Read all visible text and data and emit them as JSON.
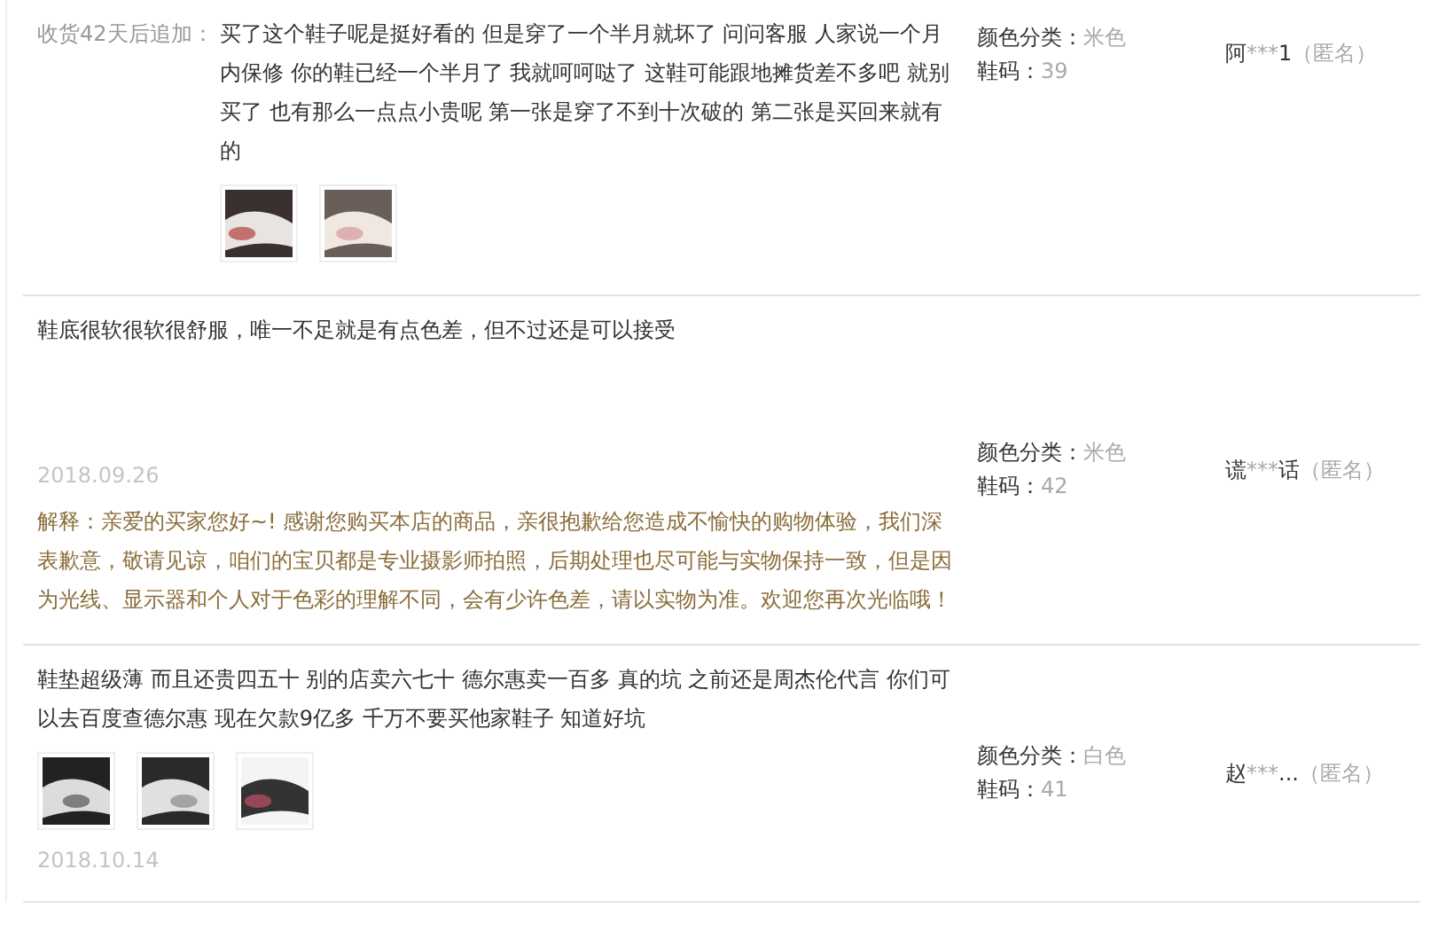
{
  "reviews": [
    {
      "append_label": "收货42天后追加：",
      "text": "买了这个鞋子呢是挺好看的 但是穿了一个半月就坏了 问问客服 人家说一个月内保修 你的鞋已经一个半月了 我就呵呵哒了 这鞋可能跟地摊货差不多吧 就别买了 也有那么一点点小贵呢 第一张是穿了不到十次破的 第二张是买回来就有的",
      "photos": [
        {
          "kind": "picture"
        },
        {
          "kind": "picture"
        }
      ],
      "attributes": [
        {
          "label": "颜色分类：",
          "value": "米色"
        },
        {
          "label": "鞋码：",
          "value": "39"
        }
      ],
      "user": {
        "name_start": "阿",
        "stars": "***",
        "name_end": "1",
        "anonymous": "（匿名）"
      }
    },
    {
      "text": "鞋底很软很软很舒服，唯一不足就是有点色差，但不过还是可以接受",
      "date": "2018.09.26",
      "reply": "解释：亲爱的买家您好~! 感谢您购买本店的商品，亲很抱歉给您造成不愉快的购物体验，我们深表歉意，敬请见谅，咱们的宝贝都是专业摄影师拍照，后期处理也尽可能与实物保持一致，但是因为光线、显示器和个人对于色彩的理解不同，会有少许色差，请以实物为准。欢迎您再次光临哦！",
      "attributes": [
        {
          "label": "颜色分类：",
          "value": "米色"
        },
        {
          "label": "鞋码：",
          "value": "42"
        }
      ],
      "user": {
        "name_start": "谎",
        "stars": "***",
        "name_end": "话",
        "anonymous": "（匿名）"
      }
    },
    {
      "text": "鞋垫超级薄 而且还贵四五十 别的店卖六七十 德尔惠卖一百多 真的坑 之前还是周杰伦代言 你们可以去百度查德尔惠 现在欠款9亿多 千万不要买他家鞋子 知道好坑",
      "photos": [
        {
          "kind": "picture"
        },
        {
          "kind": "picture"
        },
        {
          "kind": "picture"
        }
      ],
      "date": "2018.10.14",
      "attributes": [
        {
          "label": "颜色分类：",
          "value": "白色"
        },
        {
          "label": "鞋码：",
          "value": "41"
        }
      ],
      "user": {
        "name_start": "赵",
        "stars": "***",
        "name_end": "...",
        "anonymous": "（匿名）"
      }
    }
  ]
}
